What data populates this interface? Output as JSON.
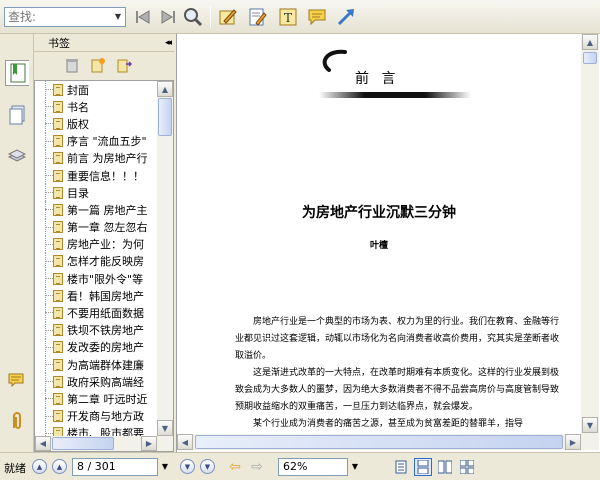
{
  "toolbar": {
    "search_placeholder": "查找:",
    "buttons": [
      "previous-result-icon",
      "next-result-icon",
      "find-icon",
      "highlight-tool-icon",
      "note-edit-icon",
      "text-tool-icon",
      "comment-tool-icon",
      "arrow-tool-icon"
    ]
  },
  "sidebar": {
    "header_title": "书签",
    "collapse_glyph": "◂◂",
    "tabs": [
      "bookmarks-icon",
      "pages-icon",
      "layers-icon",
      "comments-icon",
      "attachments-icon"
    ],
    "bookmarks": [
      "封面",
      "书名",
      "版权",
      "序言 \"流血五步\"",
      "前言 为房地产行",
      "重要信息！！！",
      "目录",
      "第一篇 房地产主",
      "第一章 忽左忽右",
      "房地产业：为何",
      "怎样才能反映房",
      "楼市\"限外令\"等",
      "看！韩国房地产",
      "不要用纸面数据",
      "铁坝不铁房地产",
      "发改委的房地产",
      "为高端群体建廉",
      "政府采购高端经",
      "第二章 吁远时近",
      "开发商与地方政",
      "楼市、股市都要"
    ]
  },
  "document": {
    "heading": "前 言",
    "title": "为房地产行业沉默三分钟",
    "author": "叶檀",
    "paragraphs": [
      "房地产行业是一个典型的市场为表、权力为里的行业。我们在教育、金融等行业都见识过这套逻辑，动辄以市场化为名向消费者收高价费用，究其实是垄断者收取溢价。",
      "这是渐进式改革的一大特点，在改革时期难有本质变化。这样的行业发展到极致会成为大多数人的噩梦，因为绝大多数消费者不得不品尝高房价与高度管制导致预期收益缩水的双重痛苦，一旦压力到达临界点，就会爆发。",
      "某个行业成为消费者的痛苦之源，甚至成为贫富差距的替罪羊，指导"
    ]
  },
  "status": {
    "ready": "就绪",
    "page": "8 / 301",
    "zoom": "62%"
  },
  "colors": {
    "chrome": "#ece9d8",
    "scroll_thumb": "#c5d3f0",
    "icon_blue": "#3a78c8",
    "icon_orange": "#e8a030",
    "icon_yellow": "#f6d24a"
  }
}
